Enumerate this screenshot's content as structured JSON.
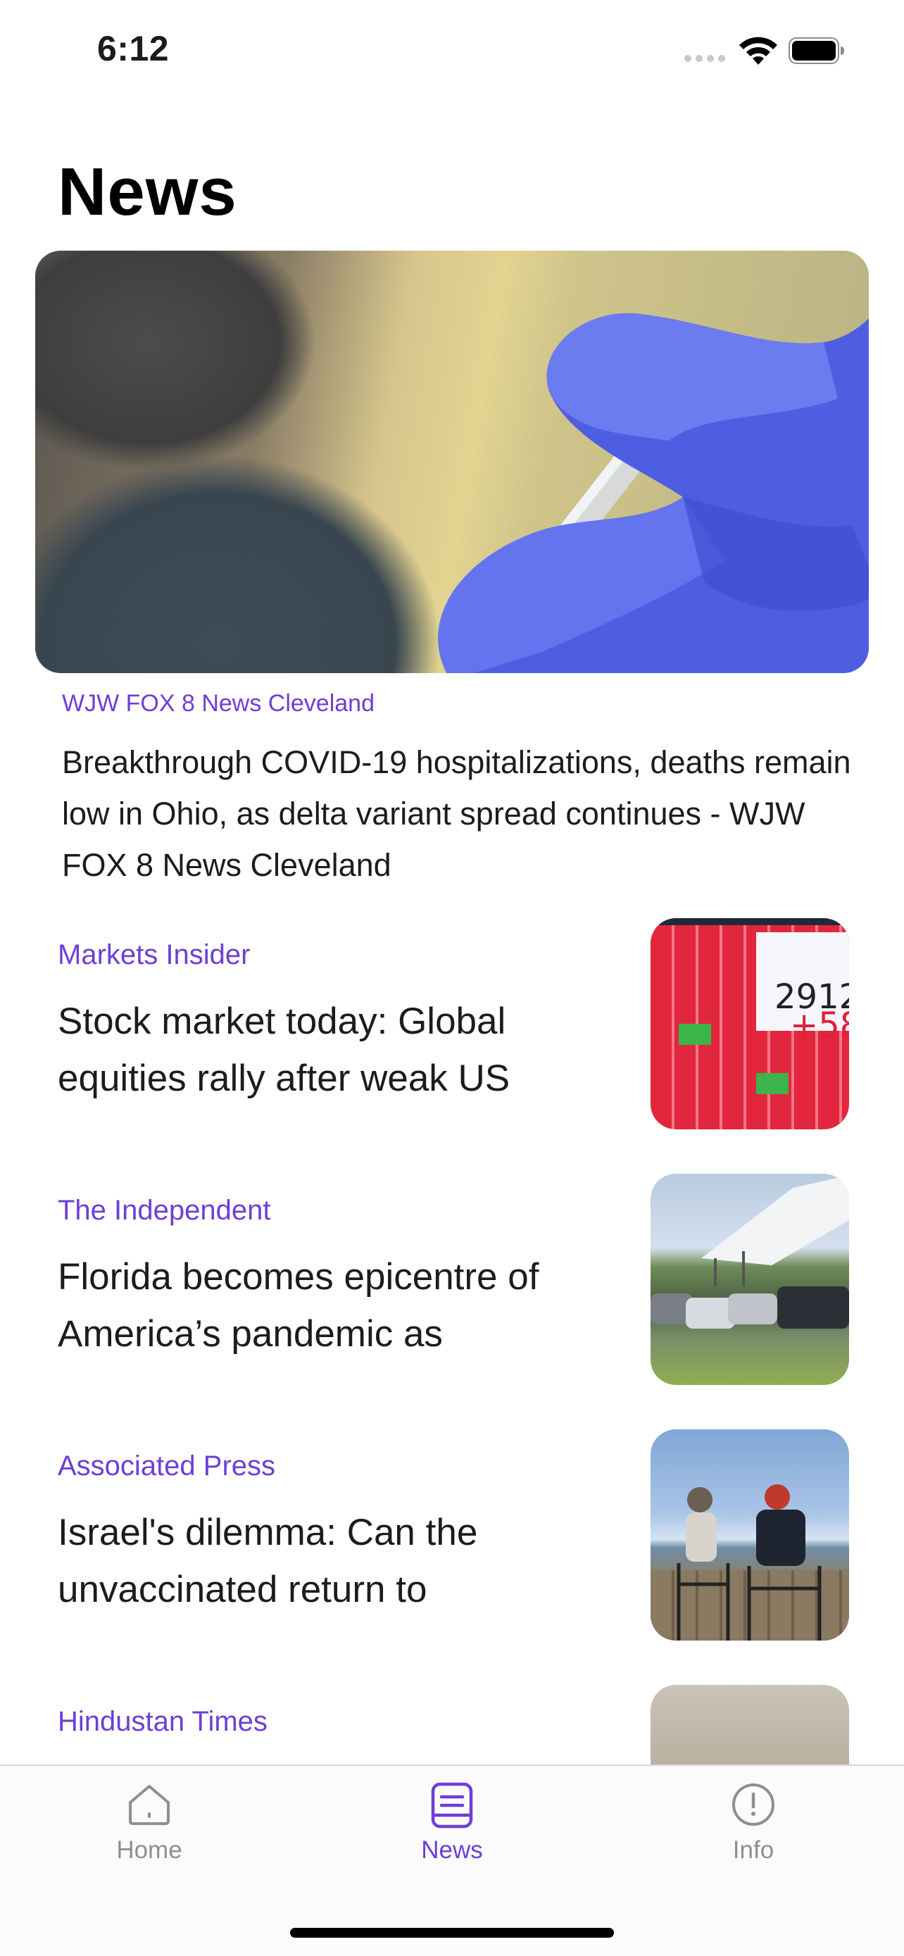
{
  "status_bar": {
    "time": "6:12",
    "icons": [
      "cellular-signal-icon",
      "wifi-icon",
      "battery-icon"
    ]
  },
  "page": {
    "title": "News"
  },
  "featured": {
    "source": "WJW FOX 8 News Cleveland",
    "headline": "Breakthrough COVID-19 hospitalizations, deaths remain low in Ohio, as delta variant spread continues - WJW FOX 8 News Cleveland",
    "image": "vaccine-syringe-photo"
  },
  "articles": [
    {
      "source": "Markets Insider",
      "headline": "Stock market today: Global equities rally after weak US",
      "thumbnail": "stock-ticker-board-photo",
      "thumb_text": [
        "2912",
        "+58"
      ]
    },
    {
      "source": "The Independent",
      "headline": "Florida becomes epicentre of America’s pandemic as",
      "thumbnail": "testing-tent-cars-photo"
    },
    {
      "source": "Associated Press",
      "headline": "Israel's dilemma: Can the unvaccinated return to",
      "thumbnail": "seaside-people-photo"
    },
    {
      "source": "Hindustan Times",
      "headline": "",
      "thumbnail": "lab-table-photo"
    }
  ],
  "tab_bar": {
    "tabs": [
      {
        "label": "Home",
        "icon": "home-icon",
        "active": false
      },
      {
        "label": "News",
        "icon": "news-icon",
        "active": true
      },
      {
        "label": "Info",
        "icon": "info-icon",
        "active": false
      }
    ]
  },
  "colors": {
    "accent": "#6e3ed6",
    "inactive": "#8e8e93",
    "text": "#1c1c1e"
  }
}
